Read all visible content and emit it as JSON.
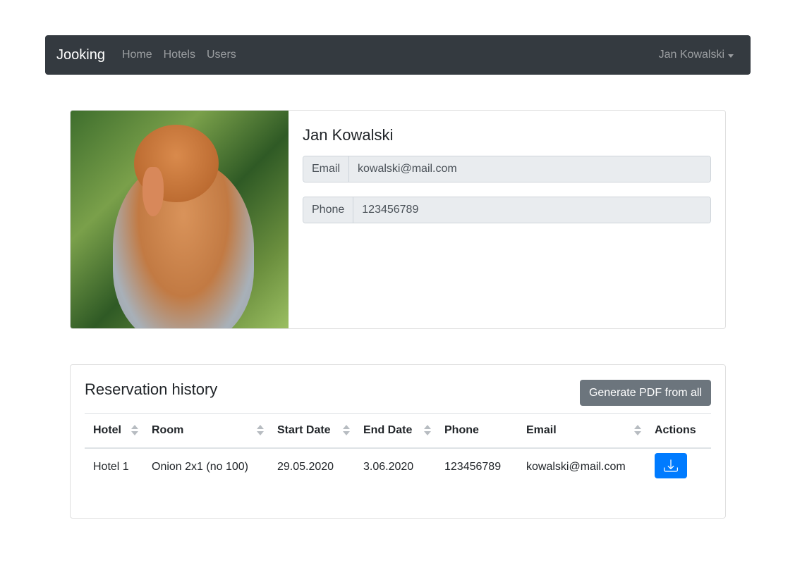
{
  "nav": {
    "brand": "Jooking",
    "links": [
      "Home",
      "Hotels",
      "Users"
    ],
    "user": "Jan Kowalski"
  },
  "profile": {
    "image": "proboscis-monkey-photo",
    "name": "Jan Kowalski",
    "email_label": "Email",
    "email": "kowalski@mail.com",
    "phone_label": "Phone",
    "phone": "123456789"
  },
  "reservations": {
    "title": "Reservation history",
    "pdf_button": "Generate PDF from all",
    "columns": [
      "Hotel",
      "Room",
      "Start Date",
      "End Date",
      "Phone",
      "Email",
      "Actions"
    ],
    "rows": [
      {
        "hotel": "Hotel 1",
        "room": "Onion 2x1 (no 100)",
        "start": "29.05.2020",
        "end": "3.06.2020",
        "phone": "123456789",
        "email": "kowalski@mail.com",
        "action_icon": "download-icon"
      }
    ]
  },
  "colors": {
    "navbar": "#343a40",
    "primary": "#007bff",
    "secondary": "#6c757d"
  }
}
